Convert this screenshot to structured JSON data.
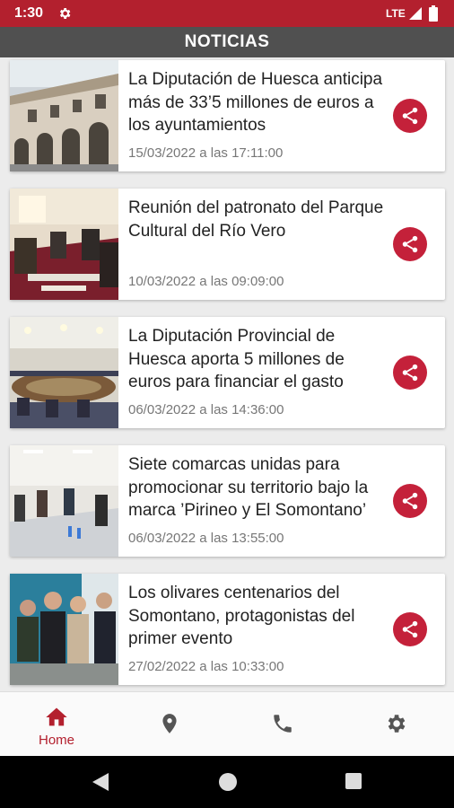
{
  "status_bar": {
    "time": "1:30",
    "network": "LTE"
  },
  "header": {
    "title": "NOTICIAS"
  },
  "news": [
    {
      "title": "La Diputación de Huesca anticipa más de 33’5 millones de euros a los ayuntamientos",
      "date": "15/03/2022 a las 17:11:00"
    },
    {
      "title": "Reunión del patronato del Parque Cultural del Río Vero",
      "date": "10/03/2022 a las 09:09:00"
    },
    {
      "title": "La Diputación Provincial de Huesca aporta 5 millones de euros para financiar el gasto",
      "date": "06/03/2022 a las 14:36:00"
    },
    {
      "title": "Siete comarcas unidas para promocionar su territorio bajo la marca ’Pirineo y El Somontano’",
      "date": "06/03/2022 a las 13:55:00"
    },
    {
      "title": "Los olivares centenarios del Somontano, protagonistas del primer evento",
      "date": "27/02/2022 a las 10:33:00"
    }
  ],
  "bottom_nav": {
    "home_label": "Home",
    "items": [
      "home-icon",
      "location-icon",
      "phone-icon",
      "settings-icon"
    ]
  },
  "colors": {
    "primary": "#b3202e",
    "header": "#505050",
    "share": "#c4213a"
  }
}
